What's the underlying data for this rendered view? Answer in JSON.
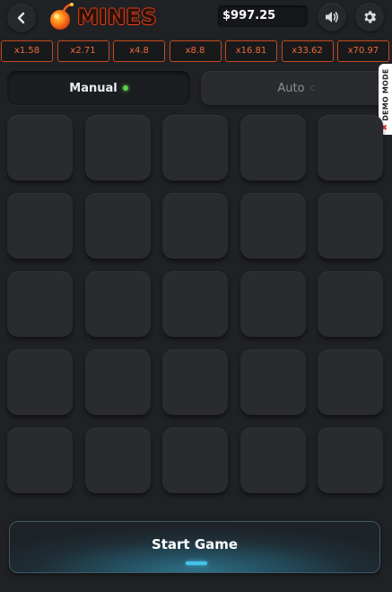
{
  "header": {
    "logo_text": "MINES",
    "balance": "$997.25",
    "icons": {
      "back": "chevron-left-icon",
      "sound": "speaker-icon",
      "settings": "gear-icon"
    }
  },
  "multipliers": [
    "x1.58",
    "x2.71",
    "x4.8",
    "x8.8",
    "x16.81",
    "x33.62",
    "x70.97"
  ],
  "mode_tabs": {
    "manual_label": "Manual",
    "auto_label": "Auto",
    "active": "manual"
  },
  "demo_badge": "DEMO MODE",
  "grid": {
    "rows": 5,
    "cols": 5
  },
  "start_button": {
    "label": "Start Game"
  },
  "colors": {
    "background": "#1f2124",
    "tile": "#292b2f",
    "multiplier_border": "#c4491e",
    "multiplier_text": "#ed6a3a",
    "active_dot": "#5fcf45",
    "start_accent": "#46c3ea"
  }
}
